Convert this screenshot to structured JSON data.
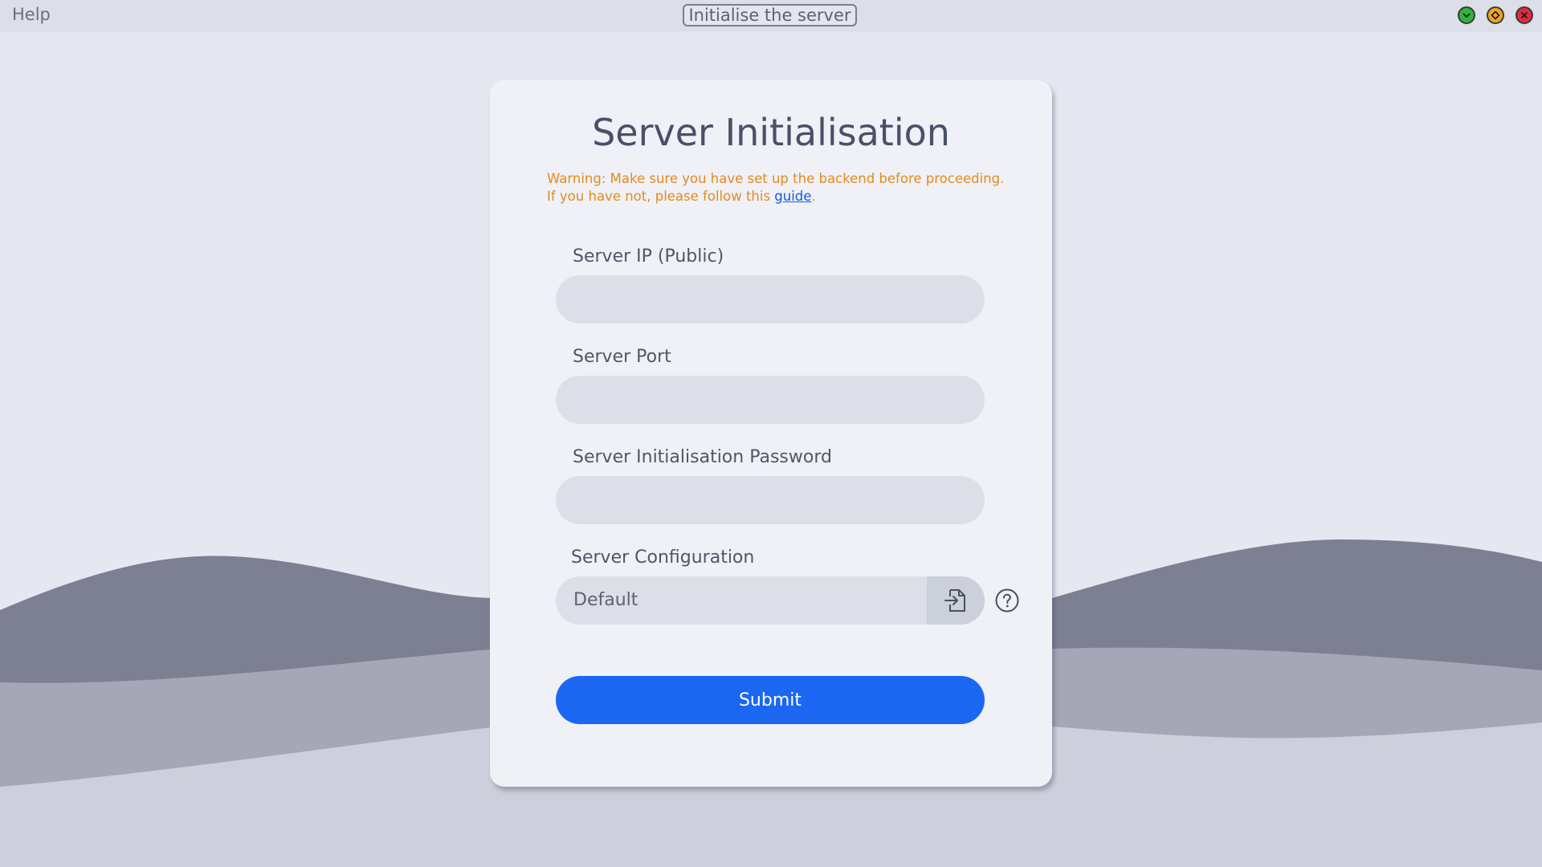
{
  "titlebar": {
    "menu_help": "Help",
    "title": "Initialise the server",
    "buttons": [
      "check-icon",
      "diamond-icon",
      "close-icon"
    ]
  },
  "card": {
    "title": "Server Initialisation",
    "warning_text": "Warning: Make sure you have set up the backend before proceeding. If you have not, please follow this ",
    "warning_link": "guide",
    "warning_end": "."
  },
  "fields": {
    "ip_label": "Server IP (Public)",
    "ip_value": "",
    "port_label": "Server Port",
    "port_value": "",
    "password_label": "Server Initialisation Password",
    "password_value": "",
    "config_label": "Server Configuration",
    "config_value": "Default"
  },
  "submit_label": "Submit",
  "colors": {
    "accent": "#1c67f2",
    "warning": "#e38b20",
    "link": "#1a55e6",
    "window_green": "#2fb33e",
    "window_orange": "#f2a51c",
    "window_red": "#e4283f"
  }
}
